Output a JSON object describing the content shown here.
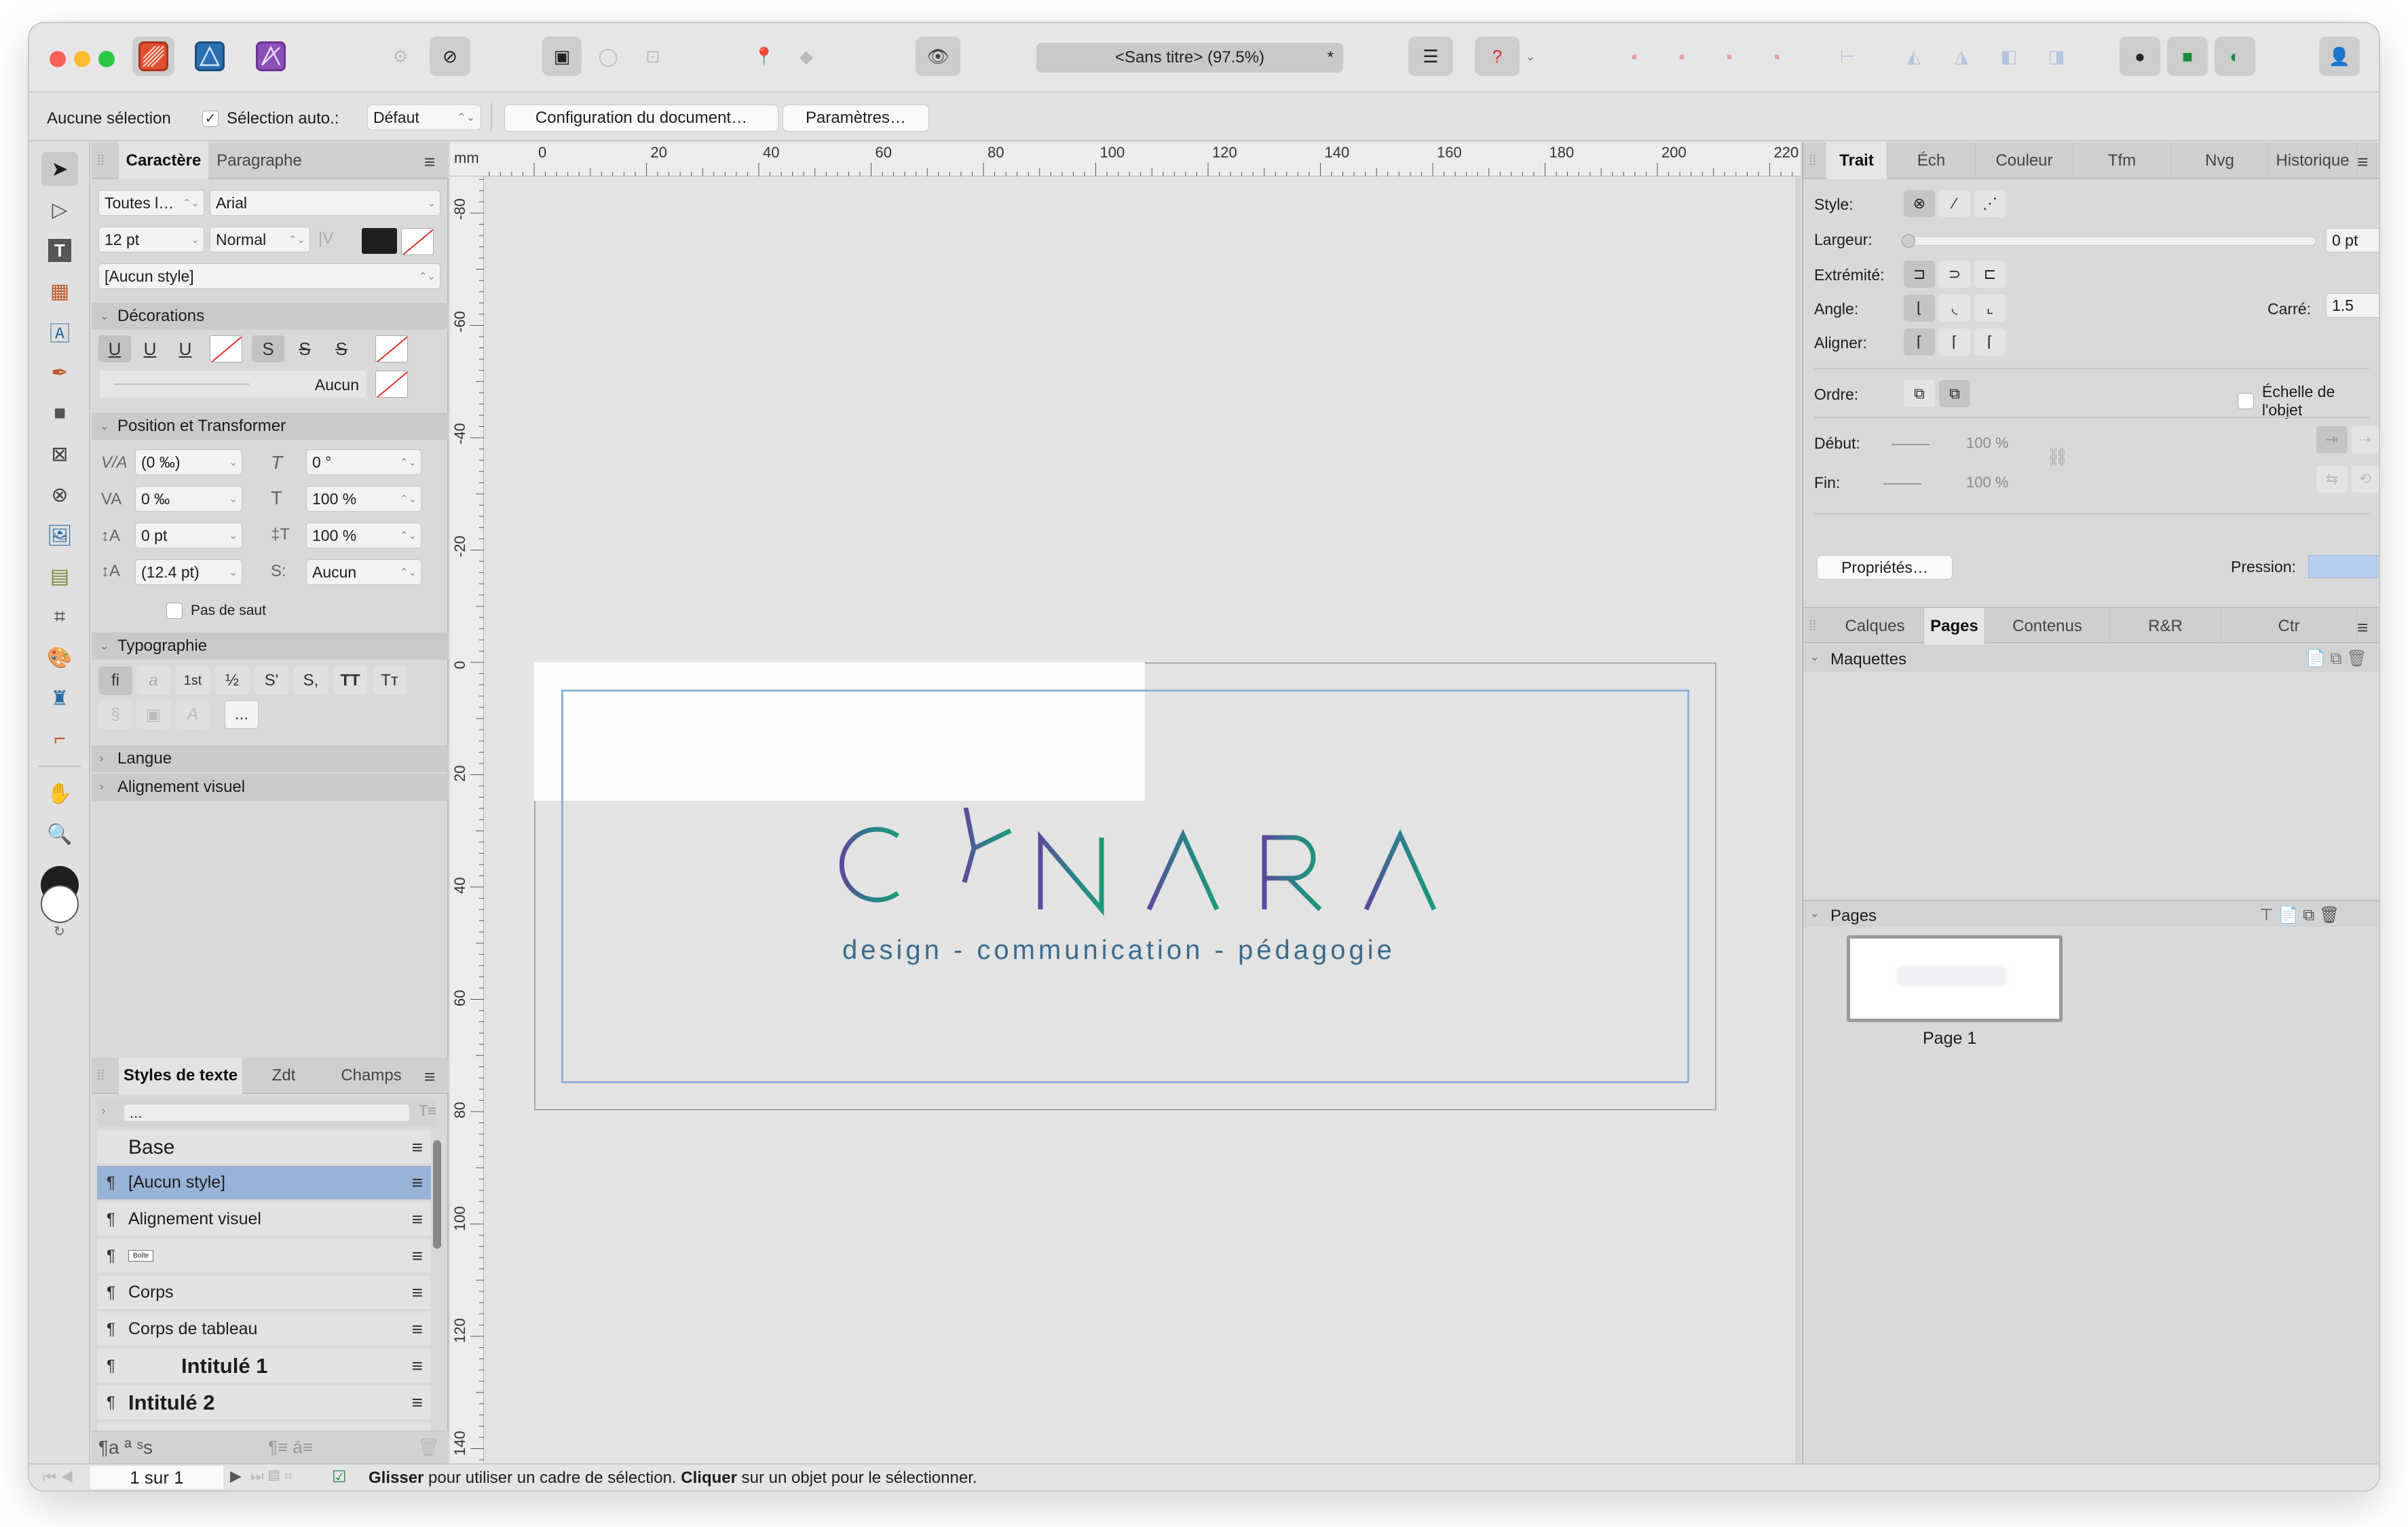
{
  "titlebar": {
    "document_title": "<Sans titre> (97.5%)",
    "modified_marker": "*"
  },
  "context": {
    "selection_label": "Aucune sélection",
    "auto_select_label": "Sélection auto.:",
    "auto_select_value": "Défaut",
    "doc_setup_button": "Configuration du document…",
    "prefs_button": "Paramètres…"
  },
  "left_panel": {
    "tabs": [
      "Caractère",
      "Paragraphe"
    ],
    "font_collection": "Toutes l…",
    "font_family": "Arial",
    "font_size": "12 pt",
    "font_style": "Normal",
    "paragraph_style": "[Aucun style]",
    "decorations_header": "Décorations",
    "underline_none_label": "Aucun",
    "position_header": "Position et Transformer",
    "kerning": "(0 ‰)",
    "tracking": "0 ‰",
    "baseline": "0 pt",
    "leading": "(12.4 pt)",
    "shear": "0 °",
    "hscale": "100 %",
    "vscale": "100 %",
    "stroke_mode": "Aucun",
    "no_break_label": "Pas de saut",
    "typography_header": "Typographie",
    "typo_buttons": [
      "fi",
      "a",
      "1st",
      "½",
      "S'",
      "S,",
      "TT",
      "Tт"
    ],
    "more_label": "...",
    "language_header": "Langue",
    "visual_align_header": "Alignement visuel"
  },
  "styles_panel": {
    "tabs": [
      "Styles de texte",
      "Zdt",
      "Champs"
    ],
    "filter_placeholder": "...",
    "rows": [
      {
        "label": "Base",
        "pil": ""
      },
      {
        "label": "[Aucun style]",
        "pil": "¶"
      },
      {
        "label": "Alignement visuel",
        "pil": "¶"
      },
      {
        "label": "Boîte",
        "pil": "¶"
      },
      {
        "label": "Corps",
        "pil": "¶"
      },
      {
        "label": "Corps de tableau",
        "pil": "¶"
      },
      {
        "label": "Intitulé 1",
        "pil": "¶"
      },
      {
        "label": "Intitulé 2",
        "pil": "¶"
      }
    ],
    "footer_icons": "¶a ª ˢs"
  },
  "canvas": {
    "ruler_unit": "mm",
    "h_ruler_labels": [
      "0",
      "20",
      "40",
      "60",
      "80",
      "100",
      "120",
      "140",
      "160",
      "180",
      "200",
      "220"
    ],
    "v_ruler_labels": [
      "-80",
      "-60",
      "-40",
      "-20",
      "0",
      "20",
      "40",
      "60",
      "80",
      "100",
      "120",
      "140"
    ],
    "logo_text": "CYNARA",
    "tagline": "design - communication - pédagogie",
    "logo_colors": [
      "#5a4a9a",
      "#2e7f8a",
      "#1b9a7a"
    ]
  },
  "right_panel": {
    "tabs": [
      "Trait",
      "Éch",
      "Couleur",
      "Tfm",
      "Nvg",
      "Historique"
    ],
    "style_label": "Style:",
    "width_label": "Largeur:",
    "width_value": "0 pt",
    "cap_label": "Extrémité:",
    "join_label": "Angle:",
    "miter_label": "Carré:",
    "miter_value": "1.5",
    "align_label": "Aligner:",
    "order_label": "Ordre:",
    "scale_label": "Échelle de l'objet",
    "start_label": "Début:",
    "start_value": "100 %",
    "end_label": "Fin:",
    "end_value": "100 %",
    "properties_button": "Propriétés…",
    "pressure_label": "Pression:",
    "pages_tabs": [
      "Calques",
      "Pages",
      "Contenus",
      "R&R",
      "Ctr"
    ],
    "masters_header": "Maquettes",
    "pages_header": "Pages",
    "page_label": "Page 1"
  },
  "status": {
    "page_nav": "1 sur 1",
    "hint_bold1": "Glisser",
    "hint_text1": " pour utiliser un cadre de sélection. ",
    "hint_bold2": "Cliquer",
    "hint_text2": " sur un objet pour le sélectionner."
  }
}
